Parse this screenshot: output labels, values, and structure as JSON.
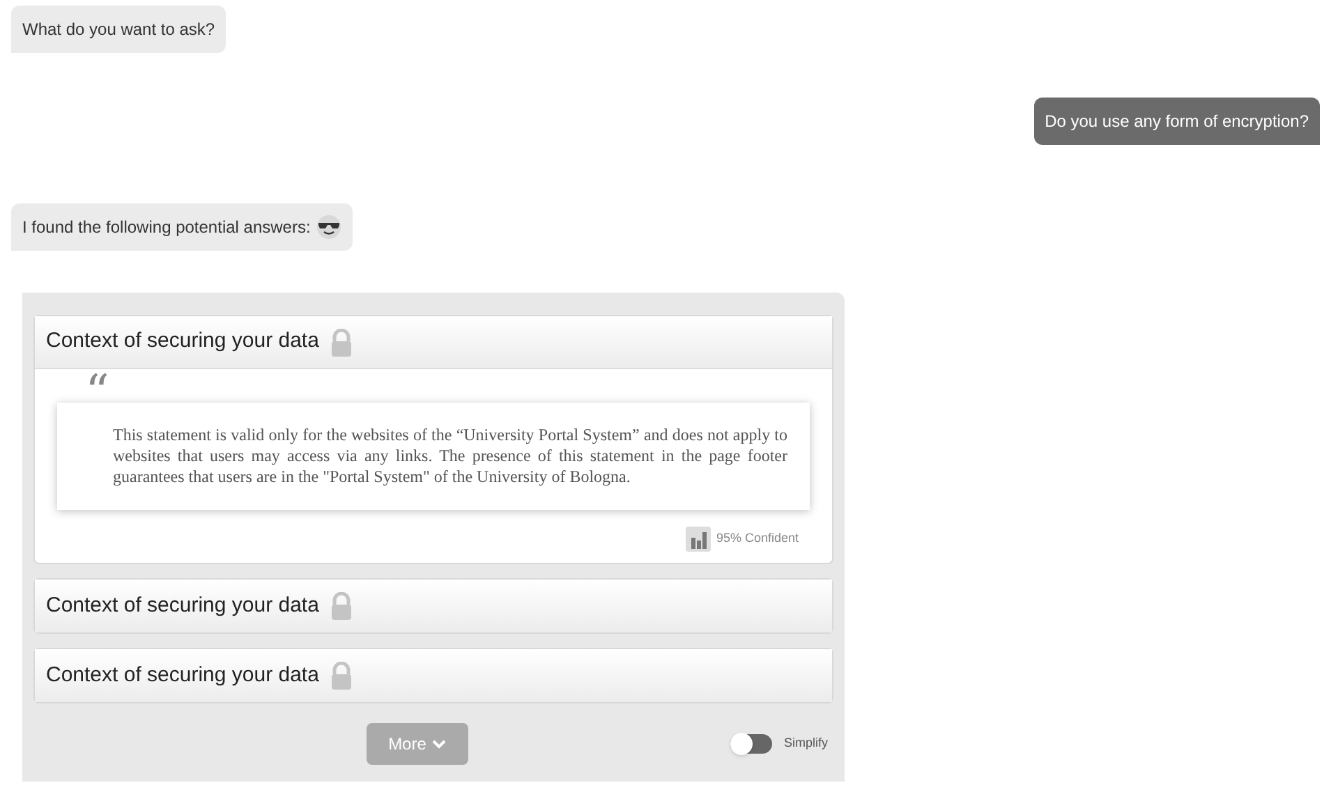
{
  "messages": [
    {
      "kind": "bot",
      "text": "What do you want to ask?",
      "emoji": false
    },
    {
      "kind": "user",
      "text": "Do you use any form of encryption?",
      "emoji": false
    },
    {
      "kind": "bot",
      "text": "I found the following potential answers:",
      "emoji": true
    }
  ],
  "answers": {
    "items": [
      {
        "title": "Context of securing your data",
        "expanded": true,
        "quote_mark": "“",
        "quote": "This statement is valid only for the websites of the “University Portal System” and does not apply to websites that users may access via any links. The presence of this statement in the page footer guarantees that users are in the \"Portal System\" of the University of Bologna.",
        "confidence": "95% Confident"
      },
      {
        "title": "Context of securing your data",
        "expanded": false
      },
      {
        "title": "Context of securing your data",
        "expanded": false
      }
    ],
    "more_button": "More",
    "simplify": {
      "label": "Simplify",
      "on": false
    }
  }
}
